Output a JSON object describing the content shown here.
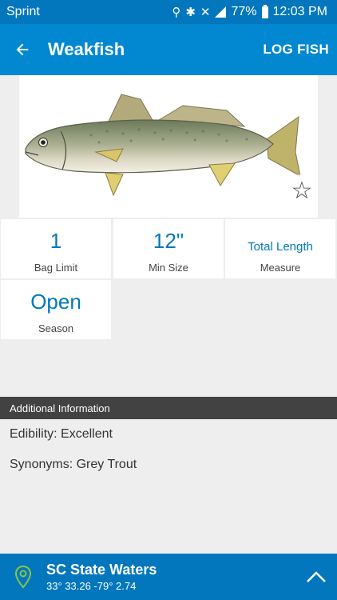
{
  "status_bar": {
    "carrier": "Sprint",
    "battery": "77%",
    "time": "12:03 PM"
  },
  "app_bar": {
    "title": "Weakfish",
    "action_label": "LOG FISH",
    "back_icon": "arrow-left-icon"
  },
  "fish_image": {
    "alt": "Weakfish illustration",
    "favorite_icon": "star-outline-icon"
  },
  "regulations": [
    {
      "value": "1",
      "label": "Bag Limit"
    },
    {
      "value": "12\"",
      "label": "Min Size"
    },
    {
      "value": "Total Length",
      "label": "Measure"
    },
    {
      "value": "Open",
      "label": "Season"
    }
  ],
  "additional_info": {
    "header": "Additional Information",
    "edibility": "Edibility: Excellent",
    "synonyms": "Synonyms: Grey Trout"
  },
  "location": {
    "name": "SC State Waters",
    "coords": "33° 33.26  -79° 2.74",
    "pin_icon": "map-pin-icon",
    "expand_icon": "chevron-up-icon"
  },
  "colors": {
    "primary": "#0288d1",
    "primary_dark": "#0277bd",
    "header_dark": "#424242",
    "pin_green": "#8bc34a"
  }
}
